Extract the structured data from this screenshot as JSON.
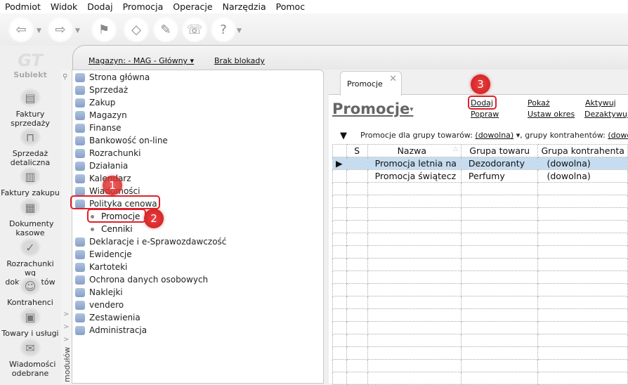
{
  "menu": [
    "Podmiot",
    "Widok",
    "Dodaj",
    "Promocja",
    "Operacje",
    "Narzędzia",
    "Pomoc"
  ],
  "logo": "Subiekt",
  "header": {
    "magazyn": "Magazyn: - MAG - Główny",
    "blokada": "Brak blokady"
  },
  "sidebar": [
    {
      "label": "Faktury sprzedaży"
    },
    {
      "label": "Sprzedaż detaliczna"
    },
    {
      "label": "Faktury zakupu"
    },
    {
      "label": "Dokumenty kasowe"
    },
    {
      "label": "Rozrachunki wg dokumentów"
    },
    {
      "label": "Kontrahenci"
    },
    {
      "label": "Towary i usługi"
    },
    {
      "label": "Wiadomości odebrane"
    }
  ],
  "modules_label": "modułów",
  "tree": [
    "Strona główna",
    "Sprzedaż",
    "Zakup",
    "Magazyn",
    "Finanse",
    "Bankowość on-line",
    "Rozrachunki",
    "Działania",
    "Kalendarz",
    "Wiadomości",
    "Polityka cenowa"
  ],
  "tree_sub": [
    "Promocje",
    "Cenniki"
  ],
  "tree_after": [
    "Deklaracje i e-Sprawozdawczość",
    "Ewidencje",
    "Kartoteki",
    "Ochrona danych osobowych",
    "Naklejki",
    "vendero",
    "Zestawienia",
    "Administracja"
  ],
  "badges": [
    "1",
    "2",
    "3"
  ],
  "tab": {
    "label": "Promocje"
  },
  "page_title": "Promocje",
  "actions": {
    "dodaj": "Dodaj",
    "popraw": "Popraw",
    "pokaz": "Pokaż",
    "ustaw_okres": "Ustaw okres",
    "aktywuj": "Aktywuj",
    "dezaktywuj": "Dezaktywuj"
  },
  "filter": {
    "label1": "Promocje dla grupy towarów:",
    "value1": "(dowolna)",
    "label2": ", grupy kontrahentów:",
    "value2": "(dowolna)"
  },
  "table": {
    "columns": [
      "S",
      "Nazwa",
      "Grupa towaru",
      "Grupa kontrahenta"
    ],
    "rows": [
      {
        "s": "",
        "nazwa": "Promocja letnia na",
        "grupa_towaru": "Dezodoranty",
        "grupa_kontrahenta": "(dowolna)"
      },
      {
        "s": "",
        "nazwa": "Promocja świątecz",
        "grupa_towaru": "Perfumy",
        "grupa_kontrahenta": "(dowolna)"
      }
    ]
  }
}
